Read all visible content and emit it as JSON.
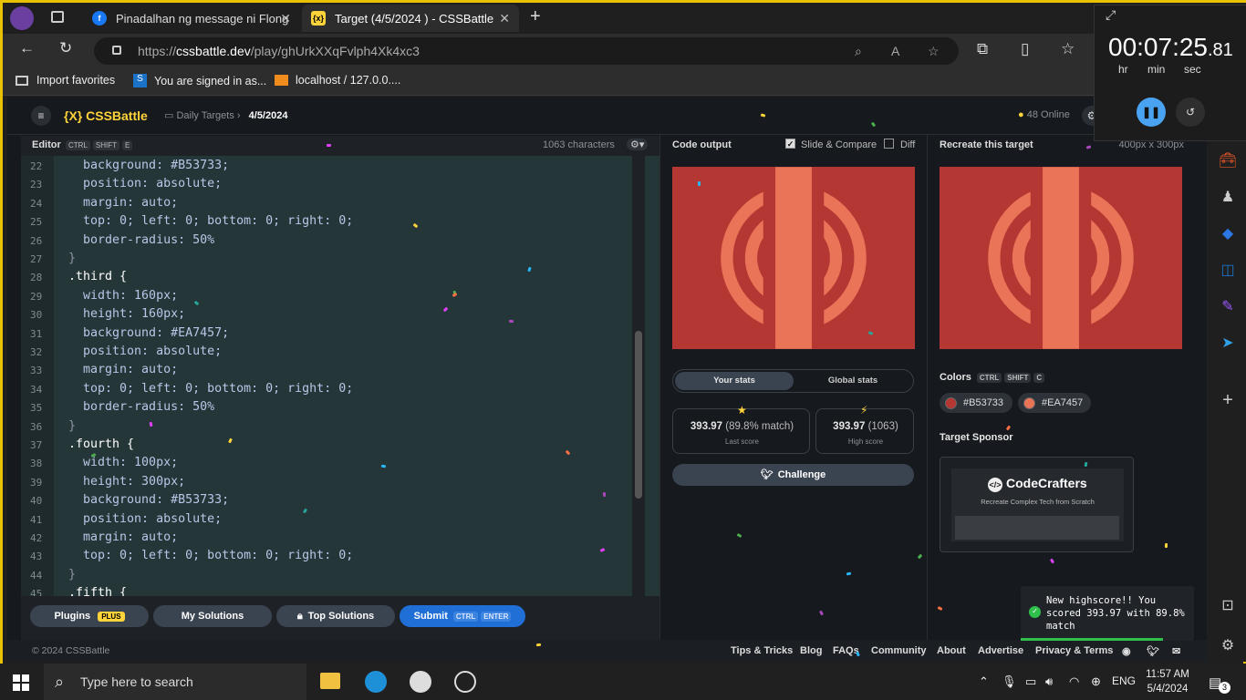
{
  "browser": {
    "tabs": [
      {
        "label": "Pinadalhan ng message ni Flong"
      },
      {
        "label": "Target (4/5/2024 ) - CSSBattle"
      }
    ],
    "url": {
      "prefix": "https://",
      "host": "cssbattle.dev",
      "path": "/play/ghUrkXXqFvlph4Xk4xc3"
    },
    "favorites": [
      {
        "label": "Import favorites"
      },
      {
        "label": "You are signed in as..."
      },
      {
        "label": "localhost / 127.0.0...."
      }
    ]
  },
  "timer": {
    "time": "00:07:25",
    "fraction": ".81",
    "units": [
      "hr",
      "min",
      "sec"
    ]
  },
  "app": {
    "logo_bracket": "{X}",
    "logo_text": "CSSBattle",
    "crumb_section": "Daily Targets",
    "crumb_date": "4/5/2024",
    "online": "48 Online"
  },
  "editor": {
    "title": "Editor",
    "keys": [
      "CTRL",
      "SHIFT",
      "E"
    ],
    "chars": "1063 characters",
    "lines": [
      {
        "n": "22",
        "t": "  background: #B53733;",
        "kind": "prop"
      },
      {
        "n": "23",
        "t": "  position: absolute;",
        "kind": "prop"
      },
      {
        "n": "24",
        "t": "  margin: auto;",
        "kind": "prop"
      },
      {
        "n": "25",
        "t": "  top: 0; left: 0; bottom: 0; right: 0;",
        "kind": "prop"
      },
      {
        "n": "26",
        "t": "  border-radius: 50%",
        "kind": "prop"
      },
      {
        "n": "27",
        "t": "}",
        "kind": "brace"
      },
      {
        "n": "28",
        "t": ".third {",
        "kind": "sel"
      },
      {
        "n": "29",
        "t": "  width: 160px;",
        "kind": "prop"
      },
      {
        "n": "30",
        "t": "  height: 160px;",
        "kind": "prop"
      },
      {
        "n": "31",
        "t": "  background: #EA7457;",
        "kind": "prop"
      },
      {
        "n": "32",
        "t": "  position: absolute;",
        "kind": "prop"
      },
      {
        "n": "33",
        "t": "  margin: auto;",
        "kind": "prop"
      },
      {
        "n": "34",
        "t": "  top: 0; left: 0; bottom: 0; right: 0;",
        "kind": "prop"
      },
      {
        "n": "35",
        "t": "  border-radius: 50%",
        "kind": "prop"
      },
      {
        "n": "36",
        "t": "}",
        "kind": "brace"
      },
      {
        "n": "37",
        "t": ".fourth {",
        "kind": "sel"
      },
      {
        "n": "38",
        "t": "  width: 100px;",
        "kind": "prop"
      },
      {
        "n": "39",
        "t": "  height: 300px;",
        "kind": "prop"
      },
      {
        "n": "40",
        "t": "  background: #B53733;",
        "kind": "prop"
      },
      {
        "n": "41",
        "t": "  position: absolute;",
        "kind": "prop"
      },
      {
        "n": "42",
        "t": "  margin: auto;",
        "kind": "prop"
      },
      {
        "n": "43",
        "t": "  top: 0; left: 0; bottom: 0; right: 0;",
        "kind": "prop"
      },
      {
        "n": "44",
        "t": "}",
        "kind": "brace"
      },
      {
        "n": "45",
        "t": ".fifth {",
        "kind": "sel"
      }
    ],
    "buttons": {
      "plugins": "Plugins",
      "plus": "PLUS",
      "solutions": "My Solutions",
      "top": "Top Solutions",
      "submit": "Submit",
      "submit_keys": [
        "CTRL",
        "ENTER"
      ]
    }
  },
  "output": {
    "title": "Code output",
    "slide": "Slide & Compare",
    "diff": "Diff",
    "tabs": [
      "Your stats",
      "Global stats"
    ],
    "last_score": "393.97",
    "last_match": "(89.8% match)",
    "last_label": "Last score",
    "high_score": "393.97",
    "high_extra": "(1063)",
    "high_label": "High score",
    "challenge": "Challenge"
  },
  "target": {
    "title": "Recreate this target",
    "size": "400px x 300px",
    "colors_label": "Colors",
    "color_keys": [
      "CTRL",
      "SHIFT",
      "C"
    ],
    "colors": [
      {
        "hex": "#B53733"
      },
      {
        "hex": "#EA7457"
      }
    ],
    "sponsor_label": "Target Sponsor",
    "sponsor_name": "CodeCrafters",
    "sponsor_tag": "Recreate Complex Tech from Scratch"
  },
  "footer": {
    "copy": "© 2024 CSSBattle",
    "links": [
      "Tips & Tricks",
      "Blog",
      "FAQs",
      "Community",
      "About",
      "Advertise",
      "Privacy & Terms"
    ]
  },
  "toast": {
    "text": "New highscore!! You scored 393.97 with 89.8% match"
  },
  "taskbar": {
    "search": "Type here to search",
    "lang": "ENG",
    "time": "11:57 AM",
    "date": "5/4/2024",
    "notif": "3"
  },
  "colors": {
    "red": "#B53733",
    "salmon": "#EA7457",
    "accent": "#ffd43b",
    "submit": "#1f6fd6"
  }
}
